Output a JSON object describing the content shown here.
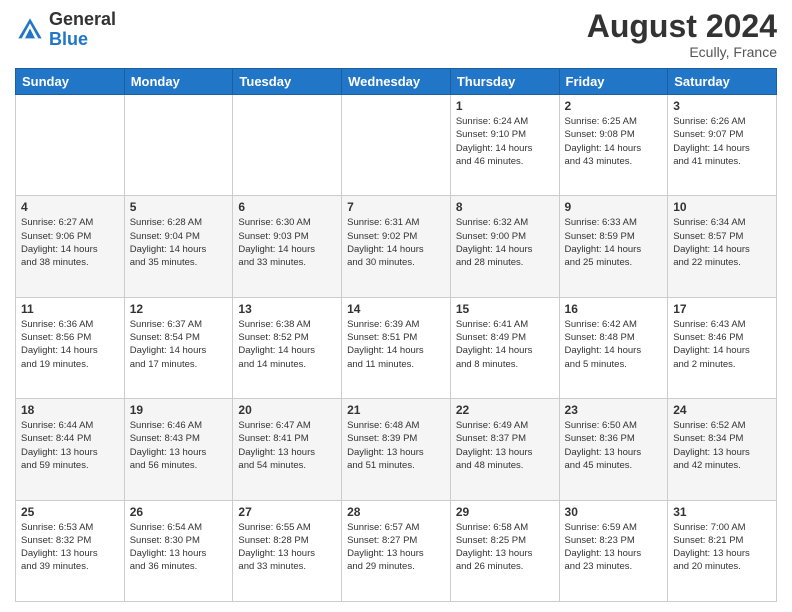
{
  "header": {
    "logo_general": "General",
    "logo_blue": "Blue",
    "month_year": "August 2024",
    "location": "Ecully, France"
  },
  "days_of_week": [
    "Sunday",
    "Monday",
    "Tuesday",
    "Wednesday",
    "Thursday",
    "Friday",
    "Saturday"
  ],
  "weeks": [
    [
      {
        "day": "",
        "info": ""
      },
      {
        "day": "",
        "info": ""
      },
      {
        "day": "",
        "info": ""
      },
      {
        "day": "",
        "info": ""
      },
      {
        "day": "1",
        "info": "Sunrise: 6:24 AM\nSunset: 9:10 PM\nDaylight: 14 hours\nand 46 minutes."
      },
      {
        "day": "2",
        "info": "Sunrise: 6:25 AM\nSunset: 9:08 PM\nDaylight: 14 hours\nand 43 minutes."
      },
      {
        "day": "3",
        "info": "Sunrise: 6:26 AM\nSunset: 9:07 PM\nDaylight: 14 hours\nand 41 minutes."
      }
    ],
    [
      {
        "day": "4",
        "info": "Sunrise: 6:27 AM\nSunset: 9:06 PM\nDaylight: 14 hours\nand 38 minutes."
      },
      {
        "day": "5",
        "info": "Sunrise: 6:28 AM\nSunset: 9:04 PM\nDaylight: 14 hours\nand 35 minutes."
      },
      {
        "day": "6",
        "info": "Sunrise: 6:30 AM\nSunset: 9:03 PM\nDaylight: 14 hours\nand 33 minutes."
      },
      {
        "day": "7",
        "info": "Sunrise: 6:31 AM\nSunset: 9:02 PM\nDaylight: 14 hours\nand 30 minutes."
      },
      {
        "day": "8",
        "info": "Sunrise: 6:32 AM\nSunset: 9:00 PM\nDaylight: 14 hours\nand 28 minutes."
      },
      {
        "day": "9",
        "info": "Sunrise: 6:33 AM\nSunset: 8:59 PM\nDaylight: 14 hours\nand 25 minutes."
      },
      {
        "day": "10",
        "info": "Sunrise: 6:34 AM\nSunset: 8:57 PM\nDaylight: 14 hours\nand 22 minutes."
      }
    ],
    [
      {
        "day": "11",
        "info": "Sunrise: 6:36 AM\nSunset: 8:56 PM\nDaylight: 14 hours\nand 19 minutes."
      },
      {
        "day": "12",
        "info": "Sunrise: 6:37 AM\nSunset: 8:54 PM\nDaylight: 14 hours\nand 17 minutes."
      },
      {
        "day": "13",
        "info": "Sunrise: 6:38 AM\nSunset: 8:52 PM\nDaylight: 14 hours\nand 14 minutes."
      },
      {
        "day": "14",
        "info": "Sunrise: 6:39 AM\nSunset: 8:51 PM\nDaylight: 14 hours\nand 11 minutes."
      },
      {
        "day": "15",
        "info": "Sunrise: 6:41 AM\nSunset: 8:49 PM\nDaylight: 14 hours\nand 8 minutes."
      },
      {
        "day": "16",
        "info": "Sunrise: 6:42 AM\nSunset: 8:48 PM\nDaylight: 14 hours\nand 5 minutes."
      },
      {
        "day": "17",
        "info": "Sunrise: 6:43 AM\nSunset: 8:46 PM\nDaylight: 14 hours\nand 2 minutes."
      }
    ],
    [
      {
        "day": "18",
        "info": "Sunrise: 6:44 AM\nSunset: 8:44 PM\nDaylight: 13 hours\nand 59 minutes."
      },
      {
        "day": "19",
        "info": "Sunrise: 6:46 AM\nSunset: 8:43 PM\nDaylight: 13 hours\nand 56 minutes."
      },
      {
        "day": "20",
        "info": "Sunrise: 6:47 AM\nSunset: 8:41 PM\nDaylight: 13 hours\nand 54 minutes."
      },
      {
        "day": "21",
        "info": "Sunrise: 6:48 AM\nSunset: 8:39 PM\nDaylight: 13 hours\nand 51 minutes."
      },
      {
        "day": "22",
        "info": "Sunrise: 6:49 AM\nSunset: 8:37 PM\nDaylight: 13 hours\nand 48 minutes."
      },
      {
        "day": "23",
        "info": "Sunrise: 6:50 AM\nSunset: 8:36 PM\nDaylight: 13 hours\nand 45 minutes."
      },
      {
        "day": "24",
        "info": "Sunrise: 6:52 AM\nSunset: 8:34 PM\nDaylight: 13 hours\nand 42 minutes."
      }
    ],
    [
      {
        "day": "25",
        "info": "Sunrise: 6:53 AM\nSunset: 8:32 PM\nDaylight: 13 hours\nand 39 minutes."
      },
      {
        "day": "26",
        "info": "Sunrise: 6:54 AM\nSunset: 8:30 PM\nDaylight: 13 hours\nand 36 minutes."
      },
      {
        "day": "27",
        "info": "Sunrise: 6:55 AM\nSunset: 8:28 PM\nDaylight: 13 hours\nand 33 minutes."
      },
      {
        "day": "28",
        "info": "Sunrise: 6:57 AM\nSunset: 8:27 PM\nDaylight: 13 hours\nand 29 minutes."
      },
      {
        "day": "29",
        "info": "Sunrise: 6:58 AM\nSunset: 8:25 PM\nDaylight: 13 hours\nand 26 minutes."
      },
      {
        "day": "30",
        "info": "Sunrise: 6:59 AM\nSunset: 8:23 PM\nDaylight: 13 hours\nand 23 minutes."
      },
      {
        "day": "31",
        "info": "Sunrise: 7:00 AM\nSunset: 8:21 PM\nDaylight: 13 hours\nand 20 minutes."
      }
    ]
  ]
}
